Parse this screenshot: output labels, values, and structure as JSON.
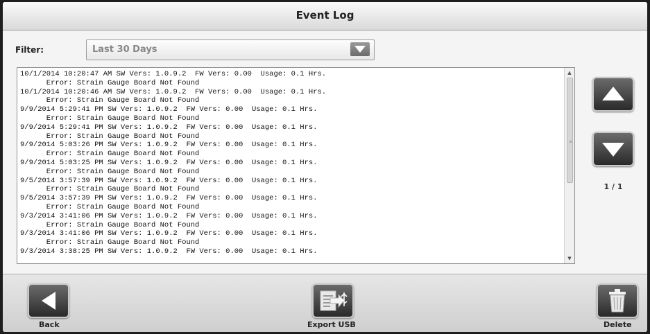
{
  "window": {
    "title": "Event Log"
  },
  "filter": {
    "label": "Filter:",
    "selected": "Last 30 Days"
  },
  "log": {
    "lines": [
      "10/1/2014 10:20:47 AM SW Vers: 1.0.9.2  FW Vers: 0.00  Usage: 0.1 Hrs.",
      "      Error: Strain Gauge Board Not Found",
      "10/1/2014 10:20:46 AM SW Vers: 1.0.9.2  FW Vers: 0.00  Usage: 0.1 Hrs.",
      "      Error: Strain Gauge Board Not Found",
      "9/9/2014 5:29:41 PM SW Vers: 1.0.9.2  FW Vers: 0.00  Usage: 0.1 Hrs.",
      "      Error: Strain Gauge Board Not Found",
      "9/9/2014 5:29:41 PM SW Vers: 1.0.9.2  FW Vers: 0.00  Usage: 0.1 Hrs.",
      "      Error: Strain Gauge Board Not Found",
      "9/9/2014 5:03:26 PM SW Vers: 1.0.9.2  FW Vers: 0.00  Usage: 0.1 Hrs.",
      "      Error: Strain Gauge Board Not Found",
      "9/9/2014 5:03:25 PM SW Vers: 1.0.9.2  FW Vers: 0.00  Usage: 0.1 Hrs.",
      "      Error: Strain Gauge Board Not Found",
      "9/5/2014 3:57:39 PM SW Vers: 1.0.9.2  FW Vers: 0.00  Usage: 0.1 Hrs.",
      "      Error: Strain Gauge Board Not Found",
      "9/5/2014 3:57:39 PM SW Vers: 1.0.9.2  FW Vers: 0.00  Usage: 0.1 Hrs.",
      "      Error: Strain Gauge Board Not Found",
      "9/3/2014 3:41:06 PM SW Vers: 1.0.9.2  FW Vers: 0.00  Usage: 0.1 Hrs.",
      "      Error: Strain Gauge Board Not Found",
      "9/3/2014 3:41:06 PM SW Vers: 1.0.9.2  FW Vers: 0.00  Usage: 0.1 Hrs.",
      "      Error: Strain Gauge Board Not Found",
      "9/3/2014 3:38:25 PM SW Vers: 1.0.9.2  FW Vers: 0.00  Usage: 0.1 Hrs."
    ]
  },
  "pagination": {
    "indicator": "1 / 1"
  },
  "buttons": {
    "back": "Back",
    "export": "Export USB",
    "delete": "Delete"
  },
  "icons": {
    "dropdown": "chevron-down-icon",
    "scroll_up": "triangle-up-icon",
    "scroll_down": "triangle-down-icon",
    "back": "triangle-left-icon",
    "export": "usb-export-icon",
    "delete": "trash-icon"
  }
}
